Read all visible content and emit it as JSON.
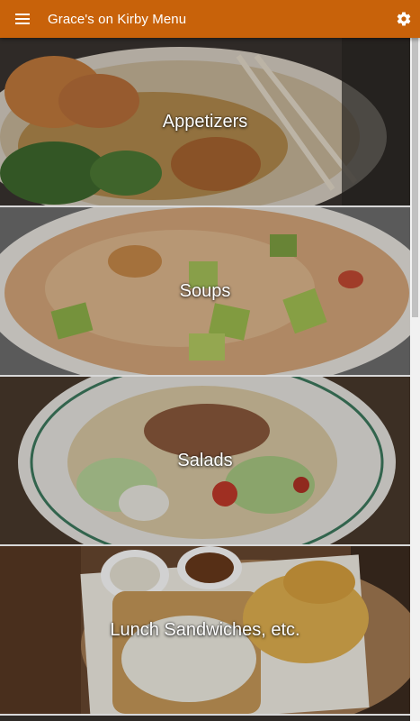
{
  "appbar": {
    "title": "Grace's on Kirby Menu",
    "menu_icon": "hamburger-menu-icon",
    "settings_icon": "gear-icon",
    "background_color": "#c8620a"
  },
  "categories": [
    {
      "label": "Appetizers"
    },
    {
      "label": "Soups"
    },
    {
      "label": "Salads"
    },
    {
      "label": "Lunch Sandwiches, etc."
    }
  ]
}
